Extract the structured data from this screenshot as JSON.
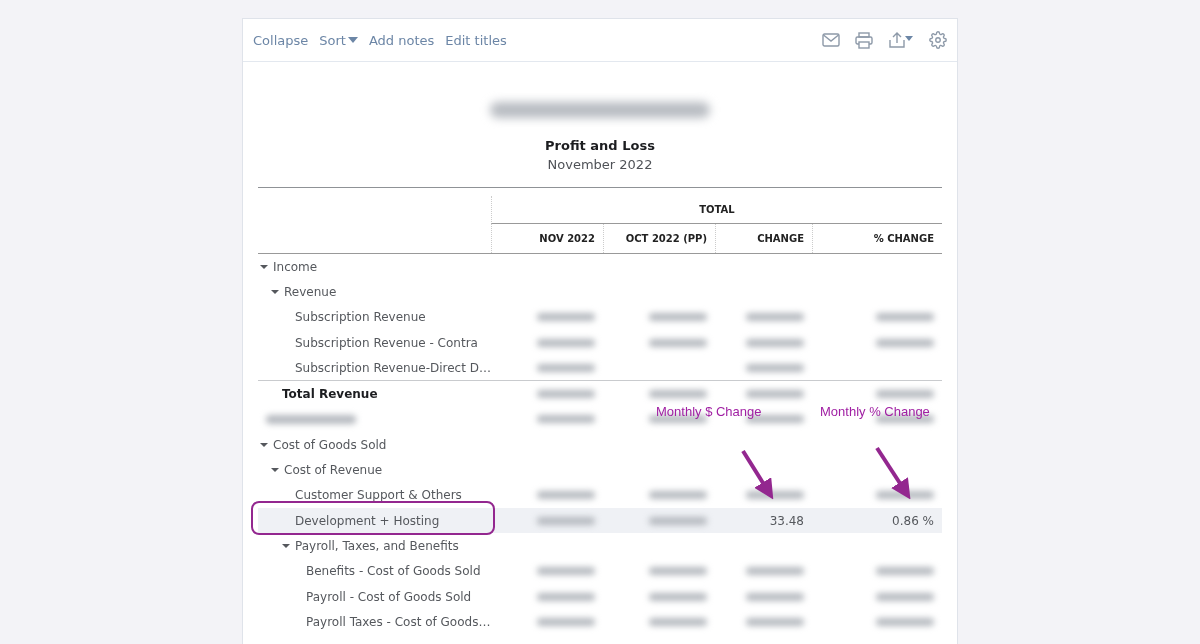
{
  "toolbar": {
    "links": [
      {
        "label": "Collapse",
        "kind": "link"
      },
      {
        "label": "Sort",
        "kind": "dropdown"
      },
      {
        "label": "Add notes",
        "kind": "link"
      },
      {
        "label": "Edit titles",
        "kind": "link"
      }
    ]
  },
  "report": {
    "company": {
      "kind": "blurred"
    },
    "title": "Profit and Loss",
    "period": "November 2022",
    "column_group": "TOTAL",
    "columns": [
      "NOV 2022",
      "OCT 2022 (PP)",
      "CHANGE",
      "% CHANGE"
    ],
    "rows": [
      {
        "kind": "group",
        "label": "Income",
        "expanded": true,
        "selected": false,
        "children": [
          {
            "kind": "group",
            "label": "Revenue",
            "expanded": true,
            "selected": false,
            "children": [
              {
                "kind": "line",
                "label": "Subscription Revenue",
                "selected": false,
                "cells": [
                  {
                    "kind": "blurred"
                  },
                  {
                    "kind": "blurred"
                  },
                  {
                    "kind": "blurred"
                  },
                  {
                    "kind": "blurred"
                  }
                ]
              },
              {
                "kind": "line",
                "label": "Subscription Revenue - Contra",
                "selected": false,
                "cells": [
                  {
                    "kind": "blurred"
                  },
                  {
                    "kind": "blurred"
                  },
                  {
                    "kind": "blurred"
                  },
                  {
                    "kind": "blurred"
                  }
                ]
              },
              {
                "kind": "line",
                "label": "Subscription Revenue-Direct D…",
                "selected": false,
                "cells": [
                  {
                    "kind": "blurred"
                  },
                  {
                    "kind": "empty"
                  },
                  {
                    "kind": "blurred"
                  },
                  {
                    "kind": "empty"
                  }
                ]
              }
            ]
          },
          {
            "kind": "total",
            "label": "Total Revenue",
            "selected": false,
            "cells": [
              {
                "kind": "blurred"
              },
              {
                "kind": "blurred"
              },
              {
                "kind": "blurred"
              },
              {
                "kind": "blurred"
              }
            ]
          }
        ]
      },
      {
        "kind": "redacted",
        "selected": false,
        "cells": [
          {
            "kind": "blurred"
          },
          {
            "kind": "blurred"
          },
          {
            "kind": "blurred"
          },
          {
            "kind": "blurred"
          }
        ]
      },
      {
        "kind": "group",
        "label": "Cost of Goods Sold",
        "expanded": true,
        "selected": false,
        "children": [
          {
            "kind": "group",
            "label": "Cost of Revenue",
            "expanded": true,
            "selected": false,
            "children": [
              {
                "kind": "line",
                "label": "Customer Support & Others",
                "selected": false,
                "cells": [
                  {
                    "kind": "blurred"
                  },
                  {
                    "kind": "blurred"
                  },
                  {
                    "kind": "blurred"
                  },
                  {
                    "kind": "blurred"
                  }
                ]
              },
              {
                "kind": "line",
                "label": "Development + Hosting",
                "selected": true,
                "cells": [
                  {
                    "kind": "blurred"
                  },
                  {
                    "kind": "blurred"
                  },
                  {
                    "kind": "text",
                    "text": "33.48"
                  },
                  {
                    "kind": "text",
                    "text": "0.86 %"
                  }
                ]
              },
              {
                "kind": "group",
                "label": "Payroll, Taxes, and Benefits",
                "expanded": true,
                "selected": false,
                "children": [
                  {
                    "kind": "line",
                    "label": "Benefits - Cost of Goods Sold",
                    "selected": false,
                    "cells": [
                      {
                        "kind": "blurred"
                      },
                      {
                        "kind": "blurred"
                      },
                      {
                        "kind": "blurred"
                      },
                      {
                        "kind": "blurred"
                      }
                    ]
                  },
                  {
                    "kind": "line",
                    "label": "Payroll - Cost of Goods Sold",
                    "selected": false,
                    "cells": [
                      {
                        "kind": "blurred"
                      },
                      {
                        "kind": "blurred"
                      },
                      {
                        "kind": "blurred"
                      },
                      {
                        "kind": "blurred"
                      }
                    ]
                  },
                  {
                    "kind": "line",
                    "label": "Payroll Taxes - Cost of Goods…",
                    "selected": false,
                    "cells": [
                      {
                        "kind": "blurred"
                      },
                      {
                        "kind": "blurred"
                      },
                      {
                        "kind": "blurred"
                      },
                      {
                        "kind": "blurred"
                      }
                    ]
                  }
                ]
              }
            ]
          }
        ]
      }
    ]
  },
  "annotations": [
    {
      "text": "Monthly $ Change"
    },
    {
      "text": "Monthly % Change"
    }
  ]
}
